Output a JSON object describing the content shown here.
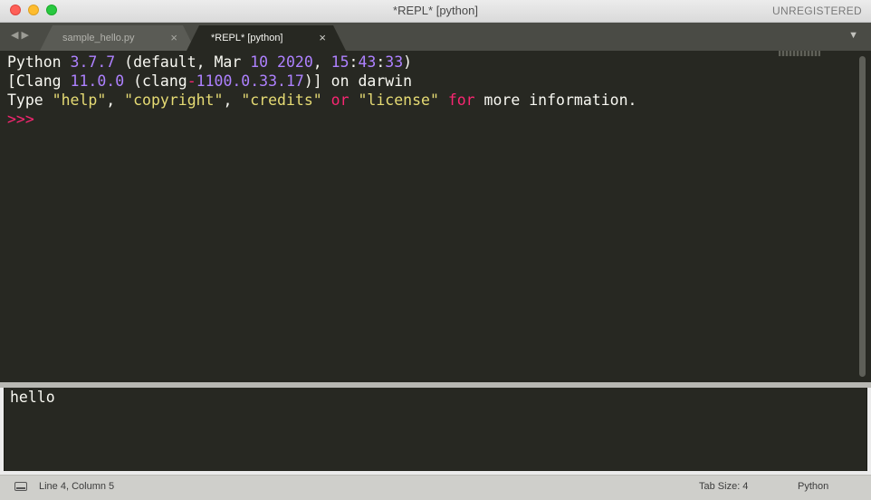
{
  "window": {
    "title": "*REPL* [python]",
    "license_status": "UNREGISTERED"
  },
  "tabs": [
    {
      "label": "sample_hello.py",
      "active": false,
      "close": "×"
    },
    {
      "label": "*REPL* [python]",
      "active": true,
      "close": "×"
    }
  ],
  "nav": {
    "back": "◀",
    "forward": "▶",
    "tab_menu": "▼"
  },
  "repl": {
    "line1": {
      "a": "Python ",
      "b": "3.7.7",
      "c": " (default, Mar ",
      "d": "10",
      "e": " ",
      "f": "2020",
      "g": ", ",
      "h": "15",
      "i": ":",
      "j": "43",
      "k": ":",
      "l": "33",
      "m": ")"
    },
    "line2": {
      "a": "[Clang ",
      "b": "11.0.0",
      "c": " (clang",
      "d": "-",
      "e": "1100.0.33.17",
      "f": ")] on darwin"
    },
    "line3": {
      "a": "Type ",
      "b": "\"help\"",
      "c": ", ",
      "d": "\"copyright\"",
      "e": ", ",
      "f": "\"credits\"",
      "g": " ",
      "h": "or",
      "i": " ",
      "j": "\"license\"",
      "k": " ",
      "l": "for",
      "m": " more information."
    },
    "prompt": ">>>"
  },
  "output_panel": {
    "text": "hello"
  },
  "status": {
    "position": "Line 4, Column 5",
    "tab_size": "Tab Size: 4",
    "syntax": "Python"
  },
  "colors": {
    "editor_bg": "#272822",
    "number": "#ae81ff",
    "string": "#e6db74",
    "keyword": "#f92672",
    "foreground": "#f8f8f2"
  }
}
